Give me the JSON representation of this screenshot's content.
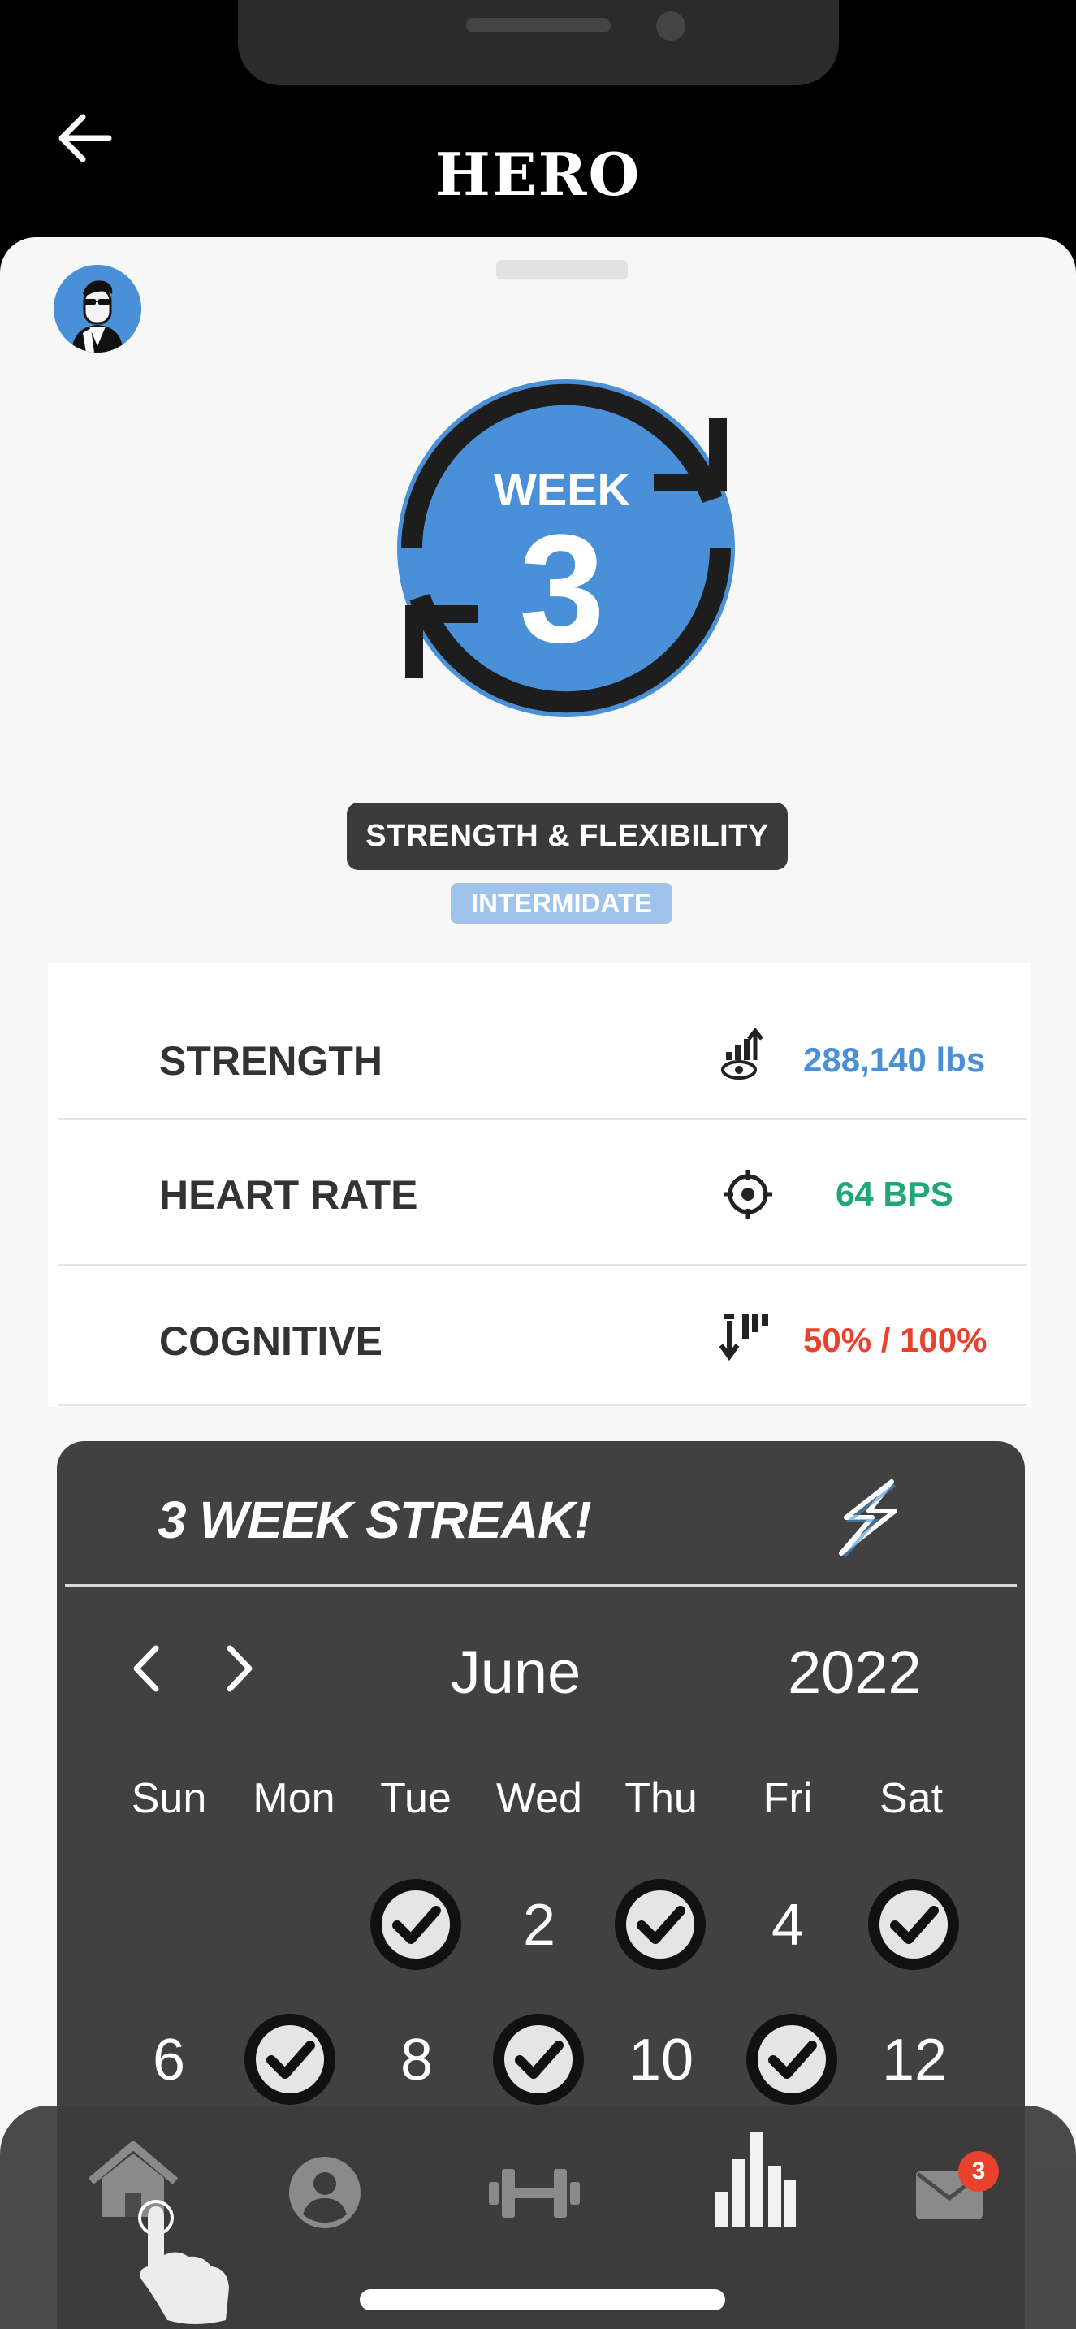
{
  "app": {
    "title": "HERO"
  },
  "program": {
    "week_label": "WEEK",
    "week_number": "3",
    "name": "STRENGTH & FLEXIBILITY",
    "level": "INTERMIDATE"
  },
  "stats": [
    {
      "label": "STRENGTH",
      "value": "288,140 lbs",
      "color": "#4a90d9",
      "icon": "strength-trend-icon"
    },
    {
      "label": "HEART RATE",
      "value": "64 BPS",
      "color": "#1fa67a",
      "icon": "target-icon"
    },
    {
      "label": "COGNITIVE",
      "value": "50% / 100%",
      "color": "#e8412c",
      "icon": "cognitive-bars-icon"
    }
  ],
  "streak": {
    "title": "3 WEEK STREAK!",
    "month": "June",
    "year": "2022",
    "weekdays": [
      "Sun",
      "Mon",
      "Tue",
      "Wed",
      "Thu",
      "Fri",
      "Sat"
    ],
    "days_row1": [
      "2",
      "4"
    ],
    "days_row2": [
      "6",
      "8",
      "10",
      "12"
    ],
    "checked_days": [
      "1",
      "3",
      "5",
      "7",
      "9",
      "11"
    ]
  },
  "tabbar": {
    "items": [
      "home",
      "profile",
      "workouts",
      "stats",
      "messages"
    ],
    "messages_badge": "3"
  },
  "colors": {
    "accent_blue": "#4a90d9",
    "header_bg": "#000000",
    "card_dark": "#414141"
  }
}
